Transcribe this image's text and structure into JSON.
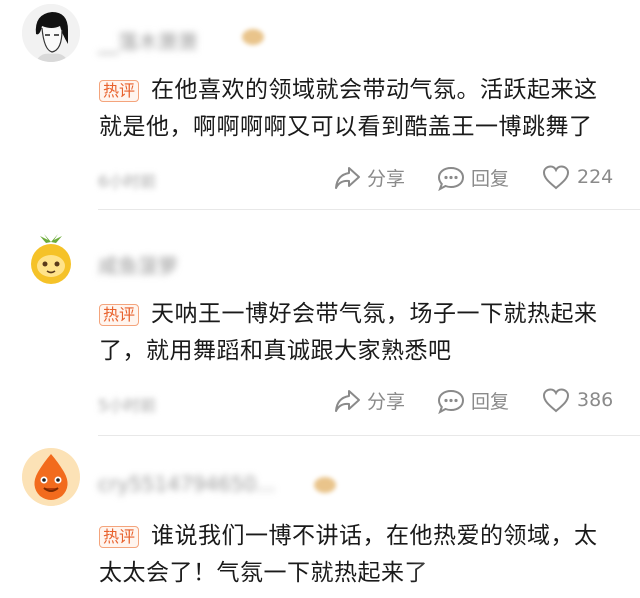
{
  "comments": [
    {
      "username": "__落木萧萧",
      "badge": "热评",
      "text": "在他喜欢的领域就会带动气氛。活跃起来这就是他，啊啊啊啊又可以看到酷盖王一博跳舞了",
      "time": "6小时前",
      "share_label": "分享",
      "reply_label": "回复",
      "likes": "224"
    },
    {
      "username": "咸鱼菠萝",
      "badge": "热评",
      "text": "天呐王一博好会带气氛，场子一下就热起来了，就用舞蹈和真诚跟大家熟悉吧",
      "time": "5小时前",
      "share_label": "分享",
      "reply_label": "回复",
      "likes": "386"
    },
    {
      "username": "cry5514794650...",
      "badge": "热评",
      "text": "谁说我们一博不讲话，在他热爱的领域，太太太会了！气氛一下就热起来了"
    }
  ],
  "icons": {
    "share": "share-icon",
    "reply": "comment-bubble-icon",
    "like": "heart-outline-icon"
  },
  "colors": {
    "badge_text": "#e8612c",
    "badge_border": "#f4a47c",
    "action_gray": "#8a8a8a"
  }
}
